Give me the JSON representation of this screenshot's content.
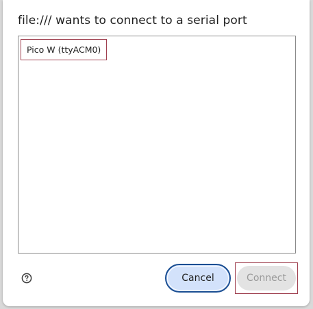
{
  "dialog": {
    "title": "file:/// wants to connect to a serial port",
    "ports": [
      {
        "label": "Pico W (ttyACM0)"
      }
    ],
    "help_icon": "help-circle-icon",
    "buttons": {
      "cancel_label": "Cancel",
      "connect_label": "Connect",
      "connect_enabled": false
    },
    "colors": {
      "accent": "#1a4e92",
      "cancel_bg": "#d3e2fb",
      "focus_outline": "#a04050",
      "disabled_bg": "#e3e3e3",
      "disabled_text": "#9a9a9a"
    }
  }
}
